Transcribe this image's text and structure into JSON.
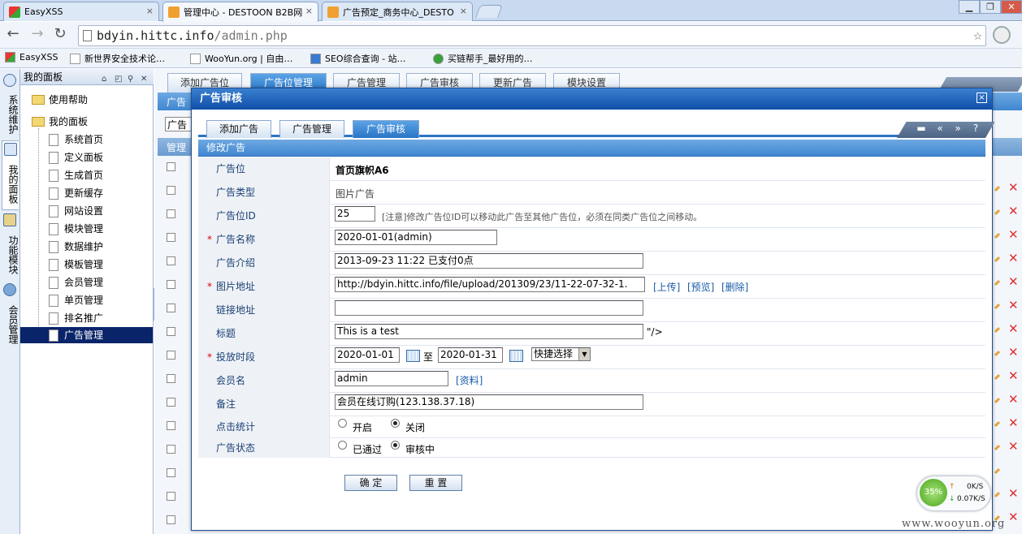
{
  "browser": {
    "tabs": [
      {
        "title": "EasyXSS",
        "active": false
      },
      {
        "title": "管理中心 - DESTOON B2B网",
        "active": true
      },
      {
        "title": "广告预定_商务中心_DESTO",
        "active": false
      }
    ],
    "tab_close": "×",
    "window_buttons": [
      "▁",
      "❐",
      "✕"
    ],
    "nav": {
      "back": "←",
      "forward": "→",
      "reload": "↻"
    },
    "address": {
      "host": "bdyin.hittc.info",
      "path": "/admin.php"
    },
    "star": "☆",
    "bookmarks": [
      "EasyXSS",
      "新世界安全技术论…",
      "WooYun.org | 自由…",
      "SEO综合查询 - 站…",
      "买链帮手_最好用的…"
    ]
  },
  "left_strip": [
    "系统维护",
    "我的面板",
    "功能模块",
    "会员管理"
  ],
  "tree": {
    "title": "我的面板",
    "header_icons": [
      "⌂",
      "◰",
      "⚲",
      "✕"
    ],
    "folders": [
      "使用帮助",
      "我的面板"
    ],
    "items": [
      "系统首页",
      "定义面板",
      "生成首页",
      "更新缓存",
      "网站设置",
      "模块管理",
      "数据维护",
      "模板管理",
      "会员管理",
      "单页管理",
      "排名推广",
      "广告管理"
    ],
    "selected": "广告管理"
  },
  "background_page": {
    "tabs": [
      "添加广告位",
      "广告位管理",
      "广告管理",
      "广告审核",
      "更新广告",
      "模块设置"
    ],
    "peek_labels": [
      "广告",
      "广告",
      "管理"
    ]
  },
  "dialog": {
    "title": "广告审核",
    "close": "×",
    "tabs": [
      "添加广告",
      "广告管理",
      "广告审核"
    ],
    "active_tab": "广告审核",
    "tool_icons": [
      "▬",
      "«",
      "»",
      "?"
    ],
    "section_title": "修改广告",
    "fields": {
      "position": {
        "label": "广告位",
        "value": "首页旗帜A6"
      },
      "type": {
        "label": "广告类型",
        "value": "图片广告"
      },
      "position_id": {
        "label": "广告位ID",
        "value": "25",
        "note": "[注意]修改广告位ID可以移动此广告至其他广告位，必须在同类广告位之间移动。"
      },
      "name": {
        "label": "广告名称",
        "value": "2020-01-01(admin)"
      },
      "intro": {
        "label": "广告介绍",
        "value": "2013-09-23 11:22 已支付0点"
      },
      "image": {
        "label": "图片地址",
        "value": "http://bdyin.hittc.info/file/upload/201309/23/11-22-07-32-1.",
        "links": [
          "[上传]",
          "[预览]",
          "[删除]"
        ]
      },
      "link": {
        "label": "链接地址",
        "value": ""
      },
      "caption": {
        "label": "标题",
        "value": "This is a test",
        "suffix": "\"/>"
      },
      "period": {
        "label": "投放时段",
        "from": "2020-01-01",
        "sep": "至",
        "to": "2020-01-31",
        "quick": "快捷选择"
      },
      "member": {
        "label": "会员名",
        "value": "admin",
        "link": "[资料]"
      },
      "remark": {
        "label": "备注",
        "value": "会员在线订购(123.138.37.18)"
      },
      "click_stats": {
        "label": "点击统计",
        "options": [
          "开启",
          "关闭"
        ],
        "selected": "关闭"
      },
      "status": {
        "label": "广告状态",
        "options": [
          "已通过",
          "审核中"
        ],
        "selected": "审核中"
      }
    },
    "required_mark": "*",
    "buttons": {
      "confirm": "确 定",
      "reset": "重 置"
    }
  },
  "speed_widget": {
    "percent": "35%",
    "up": "0K/S",
    "down": "0.07K/S",
    "up_arrow": "↑",
    "down_arrow": "↓"
  },
  "watermark": "www.wooyun.org",
  "colors": {
    "dialog_header": "#1f5fb8",
    "accent_tab": "#2a74c6",
    "selected_tree": "#0a246a",
    "required": "#dd0000"
  }
}
